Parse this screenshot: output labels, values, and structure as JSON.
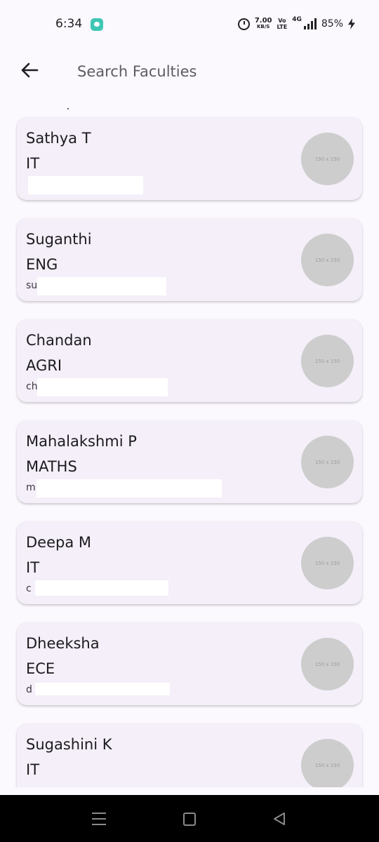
{
  "status_bar": {
    "time": "6:34",
    "network_speed": "7.00",
    "speed_unit": "KB/S",
    "volte_top": "Vo",
    "volte_bottom": "LTE",
    "network_type": "4G",
    "battery": "85%",
    "icons": [
      "chat-app-icon",
      "alarm-icon",
      "signal-icon",
      "charging-icon"
    ]
  },
  "app_bar": {
    "back_icon": "arrow-left-icon",
    "search_placeholder": "Search Faculties",
    "search_value": ""
  },
  "faculties": [
    {
      "name": "Sathya T",
      "dept": "IT",
      "email_visible": "",
      "avatar_text": "150 x 150"
    },
    {
      "name": "Suganthi",
      "dept": "ENG",
      "email_visible": "su",
      "avatar_text": "150 x 150"
    },
    {
      "name": "Chandan",
      "dept": "AGRI",
      "email_visible": "ch",
      "avatar_text": "150 x 150"
    },
    {
      "name": "Mahalakshmi P",
      "dept": "MATHS",
      "email_visible": "m",
      "avatar_text": "150 x 150"
    },
    {
      "name": "Deepa M",
      "dept": "IT",
      "email_visible": "c",
      "avatar_text": "150 x 150"
    },
    {
      "name": "Dheeksha",
      "dept": "ECE",
      "email_visible": "d",
      "avatar_text": "150 x 150"
    },
    {
      "name": "Sugashini K",
      "dept": "IT",
      "email_visible": "",
      "avatar_text": "150 x 150"
    }
  ],
  "nav_bar": {
    "icons": [
      "recent-apps-icon",
      "home-icon",
      "back-triangle-icon"
    ]
  },
  "colors": {
    "background": "#fbf8fe",
    "card": "#f4eff8",
    "avatar_placeholder": "#cdcdcd",
    "chat_badge": "#3fc7b4",
    "nav_bar": "#000000"
  }
}
